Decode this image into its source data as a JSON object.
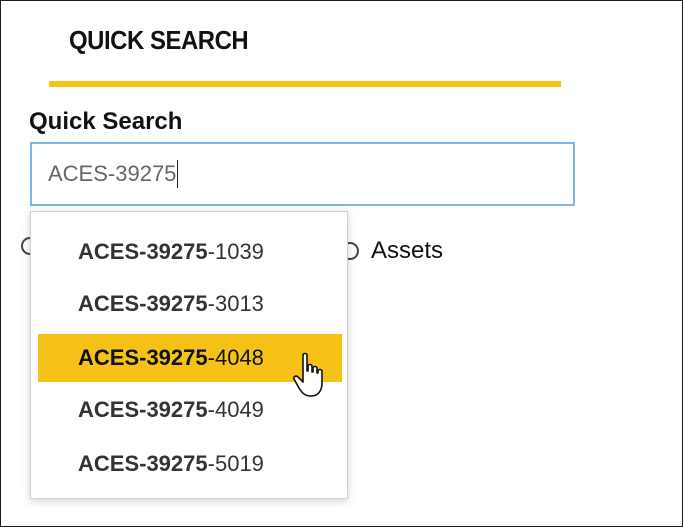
{
  "panel": {
    "title": "QUICK SEARCH",
    "accent_color": "#f6c218"
  },
  "search": {
    "label": "Quick Search",
    "value": "ACES-39275"
  },
  "radio": {
    "assets_label": "Assets"
  },
  "suggestions": [
    {
      "match": "ACES-39275",
      "suffix": "-1039",
      "highlighted": false
    },
    {
      "match": "ACES-39275",
      "suffix": "-3013",
      "highlighted": false
    },
    {
      "match": "ACES-39275",
      "suffix": "-4048",
      "highlighted": true
    },
    {
      "match": "ACES-39275",
      "suffix": "-4049",
      "highlighted": false
    },
    {
      "match": "ACES-39275",
      "suffix": "-5019",
      "highlighted": false
    }
  ]
}
